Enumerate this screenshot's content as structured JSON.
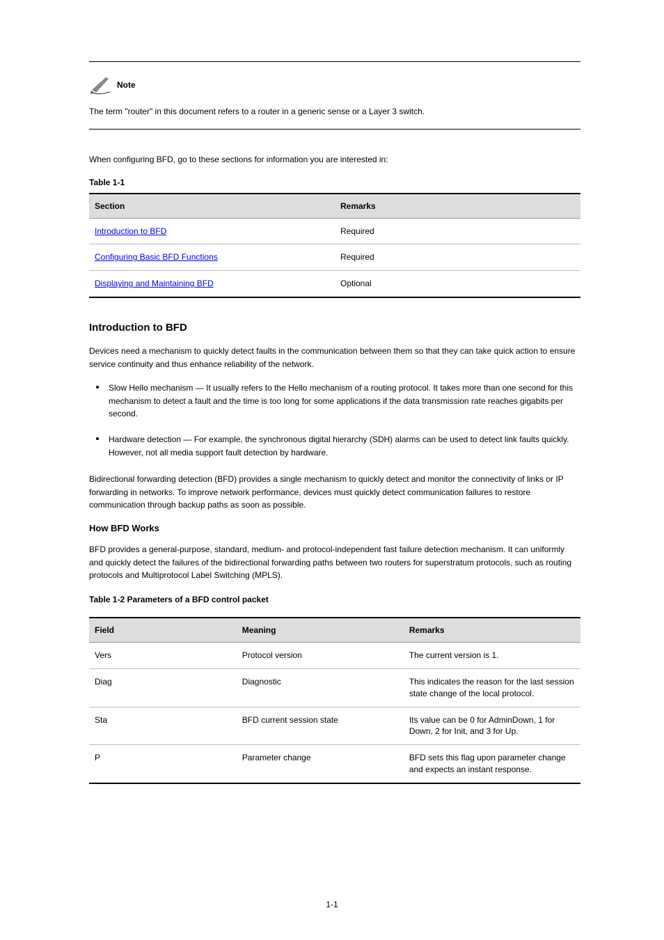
{
  "note": {
    "label": "Note",
    "text": "The term \"router\" in this document refers to a router in a generic sense or a Layer 3 switch."
  },
  "intro": {
    "para": "When configuring BFD, go to these sections for information you are interested in:",
    "table_caption": "Table 1-1",
    "table": {
      "headers": [
        "Section",
        "Remarks"
      ],
      "rows": [
        {
          "section": "Introduction to BFD",
          "section_link": true,
          "remarks": "Required"
        },
        {
          "section": "Configuring Basic BFD Functions",
          "section_link": true,
          "remarks": "Required"
        },
        {
          "section": "Displaying and Maintaining BFD",
          "section_link": true,
          "remarks": "Optional"
        }
      ]
    }
  },
  "section_bfd": {
    "heading": "Introduction to BFD",
    "para": "Devices need a mechanism to quickly detect faults in the communication between them so that they can take quick action to ensure service continuity and thus enhance reliability of the network.",
    "bullets": [
      "Slow Hello mechanism — It usually refers to the Hello mechanism of a routing protocol. It takes more than one second for this mechanism to detect a fault and the time is too long for some applications if the data transmission rate reaches gigabits per second.",
      "Hardware detection — For example, the synchronous digital hierarchy (SDH) alarms can be used to detect link faults quickly. However, not all media support fault detection by hardware."
    ],
    "para2": "Bidirectional forwarding detection (BFD) provides a single mechanism to quickly detect and monitor the connectivity of links or IP forwarding in networks. To improve network performance, devices must quickly detect communication failures to restore communication through backup paths as soon as possible."
  },
  "how_works": {
    "heading": "How BFD Works",
    "para": "BFD provides a general-purpose, standard, medium- and protocol-independent fast failure detection mechanism. It can uniformly and quickly detect the failures of the bidirectional forwarding paths between two routers for superstratum protocols, such as routing protocols and Multiprotocol Label Switching (MPLS).",
    "table_caption": "Table 1-2 Parameters of a BFD control packet",
    "table": {
      "headers": [
        "Field",
        "Meaning",
        "Remarks"
      ],
      "rows": [
        {
          "field": "Vers",
          "meaning": "Protocol version",
          "remarks": "The current version is 1."
        },
        {
          "field": "Diag",
          "meaning": "Diagnostic",
          "remarks": "This indicates the reason for the last session state change of the local protocol."
        },
        {
          "field": "Sta",
          "meaning": "BFD current session state",
          "remarks": "Its value can be 0 for AdminDown, 1 for Down, 2 for Init, and 3 for Up."
        },
        {
          "field": "P",
          "meaning": "Parameter change",
          "remarks": "BFD sets this flag upon parameter change and expects an instant response."
        }
      ]
    }
  },
  "page_number": "1-1"
}
